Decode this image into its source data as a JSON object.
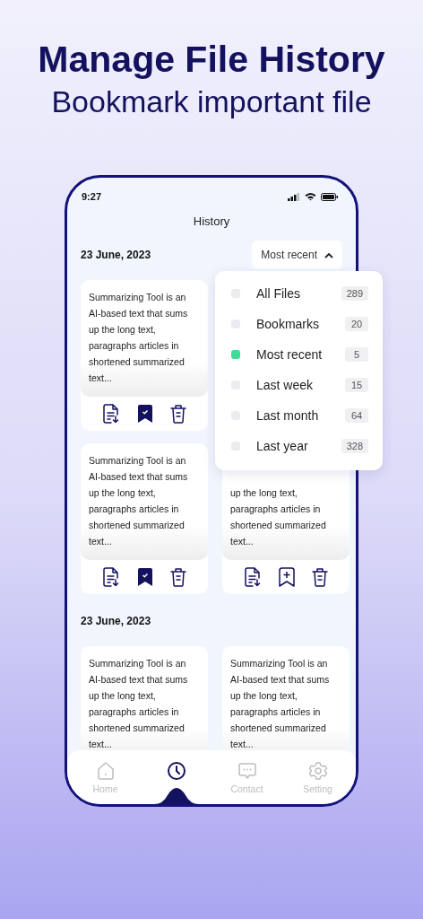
{
  "heading": {
    "title": "Manage File History",
    "subtitle": "Bookmark important file"
  },
  "status_bar": {
    "time": "9:27"
  },
  "screen_title": "History",
  "sort_button": {
    "label": "Most recent",
    "expanded": true
  },
  "sections": [
    {
      "date": "23 June, 2023",
      "rows": [
        {
          "cards": [
            {
              "kind": "full",
              "text": "Summarizing Tool is an\nAI-based text that sums\nup the long text,\nparagraphs articles in\nshortened summarized\ntext...",
              "bookmarked": true
            }
          ]
        },
        {
          "cards": [
            {
              "kind": "full",
              "text": "Summarizing Tool is an\nAI-based text that sums\nup the long text,\nparagraphs articles in\nshortened summarized\ntext...",
              "bookmarked": true
            },
            {
              "kind": "partial",
              "text": "up the long text,\nparagraphs articles in\nshortened summarized\ntext...",
              "bookmarked": false
            }
          ]
        }
      ]
    },
    {
      "date": "23 June, 2023",
      "rows": [
        {
          "cards": [
            {
              "kind": "clipped",
              "text": "Summarizing Tool is an\nAI-based text that sums\nup the long text,\nparagraphs articles in\nshortened summarized\ntext..."
            },
            {
              "kind": "clipped",
              "text": "Summarizing Tool is an\nAI-based text that sums\nup the long text,\nparagraphs articles in\nshortened summarized\ntext..."
            }
          ]
        }
      ]
    }
  ],
  "sort_menu": {
    "items": [
      {
        "label": "All Files",
        "count": "289",
        "selected": false
      },
      {
        "label": "Bookmarks",
        "count": "20",
        "selected": false
      },
      {
        "label": "Most recent",
        "count": "5",
        "selected": true
      },
      {
        "label": "Last week",
        "count": "15",
        "selected": false
      },
      {
        "label": "Last month",
        "count": "64",
        "selected": false
      },
      {
        "label": "Last year",
        "count": "328",
        "selected": false
      }
    ]
  },
  "nav": {
    "items": [
      {
        "kind": "home",
        "label": "Home",
        "selected": false
      },
      {
        "kind": "history",
        "selected": true
      },
      {
        "kind": "contact",
        "label": "Contact",
        "selected": false
      },
      {
        "kind": "setting",
        "label": "Setting",
        "selected": false
      }
    ]
  }
}
